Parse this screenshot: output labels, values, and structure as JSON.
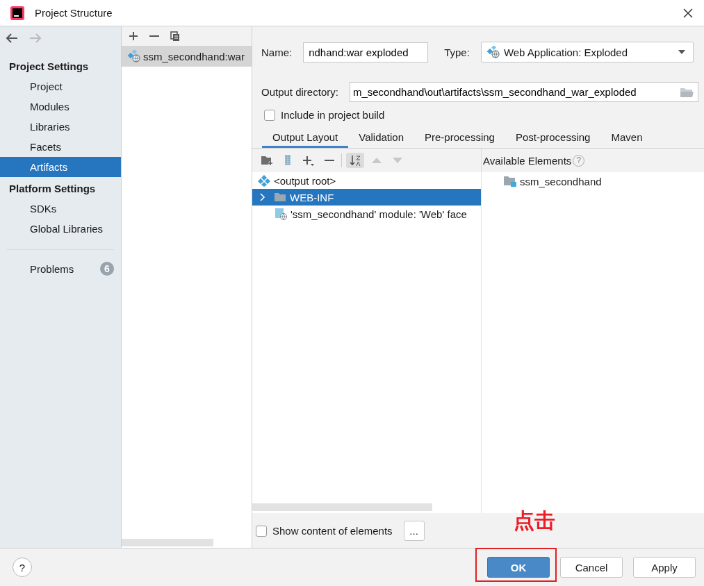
{
  "window": {
    "title": "Project Structure"
  },
  "navigation": {
    "back_enabled": true,
    "forward_enabled": false
  },
  "sidebar": {
    "sections": [
      {
        "heading": "Project Settings",
        "items": [
          {
            "label": "Project",
            "selected": false
          },
          {
            "label": "Modules",
            "selected": false
          },
          {
            "label": "Libraries",
            "selected": false
          },
          {
            "label": "Facets",
            "selected": false
          },
          {
            "label": "Artifacts",
            "selected": true
          }
        ]
      },
      {
        "heading": "Platform Settings",
        "items": [
          {
            "label": "SDKs",
            "selected": false
          },
          {
            "label": "Global Libraries",
            "selected": false
          }
        ]
      }
    ],
    "problems": {
      "label": "Problems",
      "count": "6"
    }
  },
  "artifacts": {
    "items": [
      {
        "label": "ssm_secondhand:war",
        "selected": true
      }
    ]
  },
  "form": {
    "name_label": "Name:",
    "name_value": "ndhand:war exploded",
    "type_label": "Type:",
    "type_value": "Web Application: Exploded",
    "output_label": "Output directory:",
    "output_value": "m_secondhand\\out\\artifacts\\ssm_secondhand_war_exploded",
    "include_in_build": {
      "label": "Include in project build",
      "checked": false
    }
  },
  "tabs": [
    {
      "label": "Output Layout",
      "selected": true
    },
    {
      "label": "Validation",
      "selected": false
    },
    {
      "label": "Pre-processing",
      "selected": false
    },
    {
      "label": "Post-processing",
      "selected": false
    },
    {
      "label": "Maven",
      "selected": false
    }
  ],
  "output_layout": {
    "items": [
      {
        "label": "<output root>",
        "kind": "root",
        "selected": false
      },
      {
        "label": "WEB-INF",
        "kind": "folder",
        "selected": true,
        "expanded": false
      },
      {
        "label": "'ssm_secondhand' module: 'Web' face",
        "kind": "facet",
        "selected": false
      }
    ]
  },
  "available_elements": {
    "title": "Available Elements",
    "help": "?",
    "items": [
      {
        "label": "ssm_secondhand",
        "kind": "module"
      }
    ]
  },
  "show_content": {
    "label": "Show content of elements",
    "checked": false,
    "more": "..."
  },
  "help_button": "?",
  "buttons": [
    {
      "label": "OK",
      "kind": "primary",
      "highlighted": true
    },
    {
      "label": "Cancel",
      "kind": "normal",
      "highlighted": false
    },
    {
      "label": "Apply",
      "kind": "normal",
      "highlighted": false
    }
  ],
  "annotation": {
    "text": "点击"
  }
}
